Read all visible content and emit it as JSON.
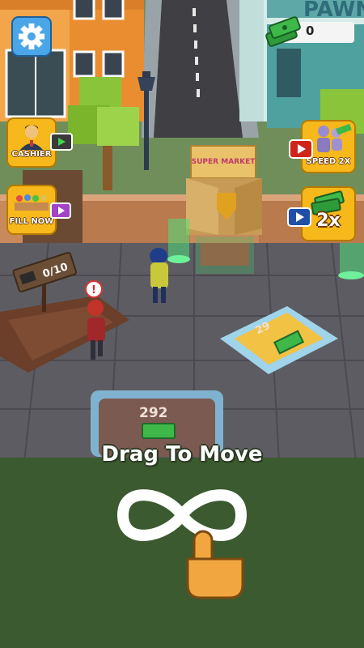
{
  "hud": {
    "cash_amount": "0",
    "settings_icon": "gear-icon",
    "money_icon": "cash-stack-icon"
  },
  "buttons": {
    "cashier": {
      "label": "CASHIER",
      "badge": "video-ad-icon",
      "badge_color": "#3a3a3a"
    },
    "fill_now": {
      "label": "FILL NOW",
      "badge": "video-ad-icon",
      "badge_color": "#a243c8"
    },
    "speed": {
      "label": "SPEED 2X",
      "badge": "video-ad-icon",
      "badge_color": "#d0241b"
    },
    "money_boost": {
      "label": "2x",
      "badge": "video-ad-icon",
      "badge_color": "#1f4fa8"
    }
  },
  "world": {
    "street_sign": "PAWN",
    "shop_sign": "SUPER MARKET",
    "shelf_counter": "0/10",
    "diamond_pad_value": "29",
    "purchase_pad_value": "292"
  },
  "tutorial": {
    "instruction": "Drag To Move",
    "gesture_icon": "infinity-swipe-icon",
    "hand_icon": "pointing-hand-icon"
  },
  "colors": {
    "button_yellow": "#f6b81a",
    "accent_green": "#3fb84a",
    "ground_green": "#3b5a2f"
  }
}
